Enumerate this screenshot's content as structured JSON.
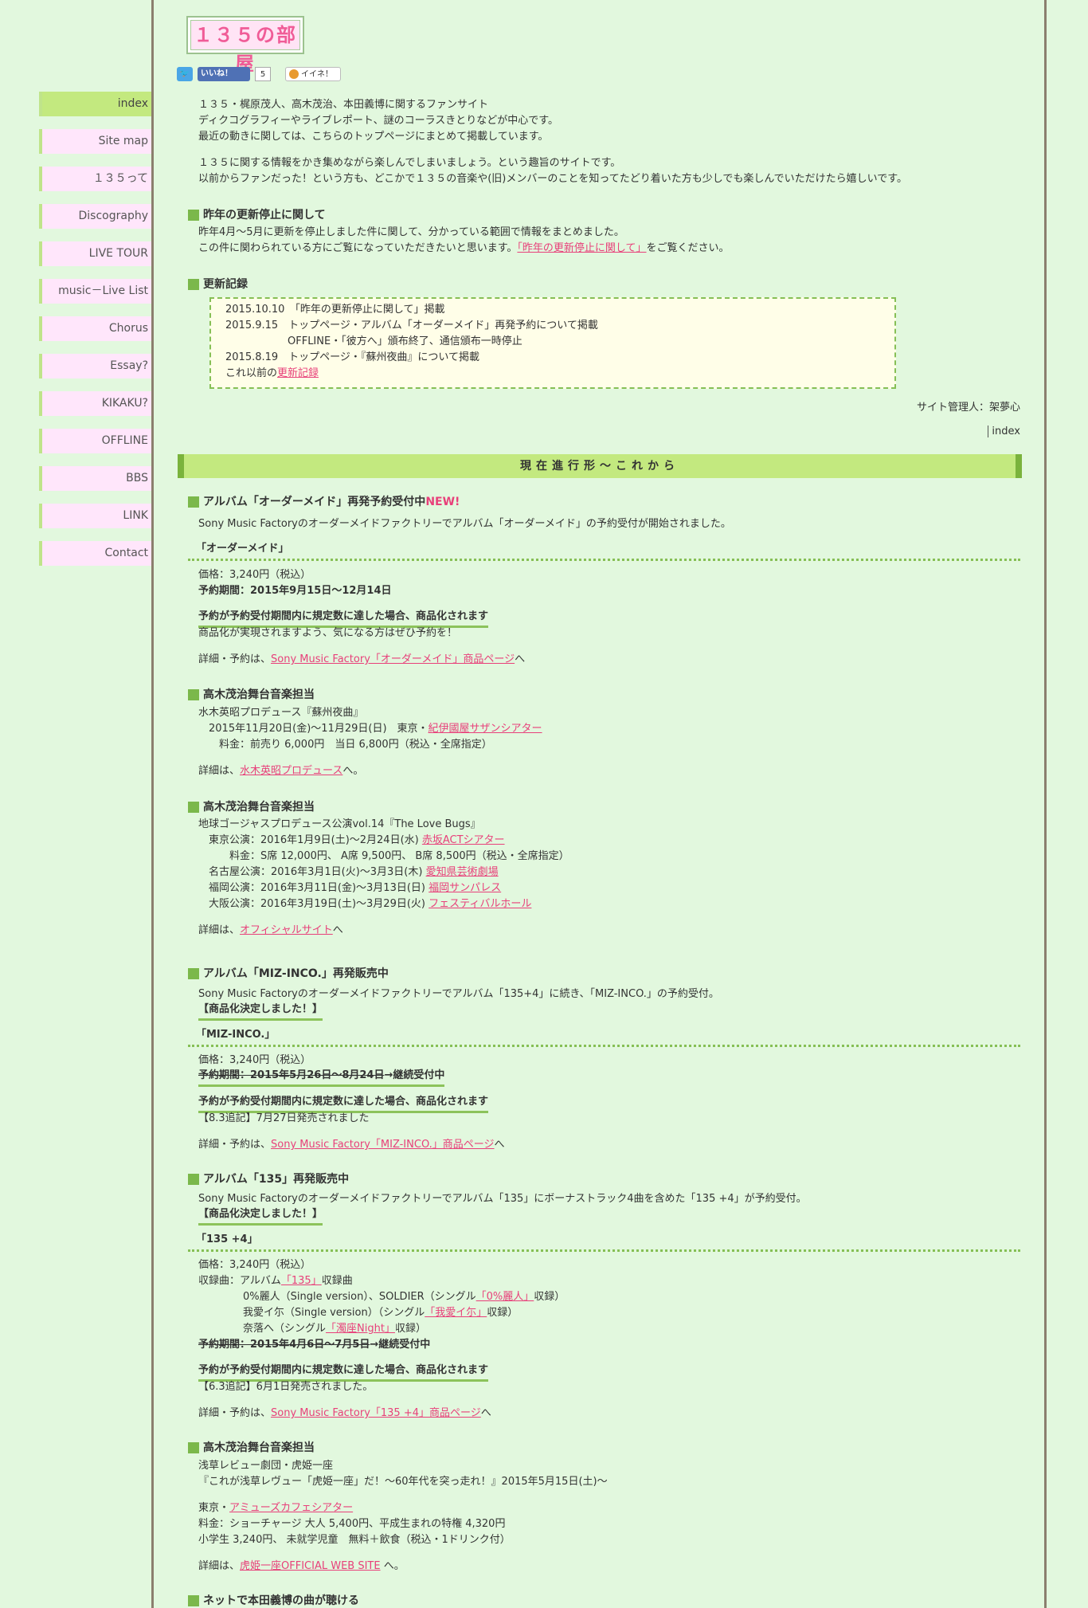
{
  "site": {
    "logo": "１３５の部屋"
  },
  "social": {
    "tweet": "",
    "like_label": "いいね！",
    "like_count": "5",
    "mixi_label": "イイネ！"
  },
  "nav": [
    {
      "label": "index",
      "active": true
    },
    {
      "label": "Site map"
    },
    {
      "label": "１３５って"
    },
    {
      "label": "Discography"
    },
    {
      "label": "LIVE TOUR"
    },
    {
      "label": "music－Live List"
    },
    {
      "label": "Chorus"
    },
    {
      "label": "Essay?"
    },
    {
      "label": "KIKAKU?"
    },
    {
      "label": "OFFLINE"
    },
    {
      "label": "BBS"
    },
    {
      "label": "LINK"
    },
    {
      "label": "Contact"
    }
  ],
  "intro": {
    "l1": "１３５・梶原茂人、高木茂治、本田義博に関するファンサイト",
    "l2": "ディクコグラフィーやライブレポート、謎のコーラスきとりなどが中心です。",
    "l3": "最近の動きに関しては、こちらのトップページにまとめて掲載しています。",
    "l4": "１３５に関する情報をかき集めながら楽しんでしまいましょう。という趣旨のサイトです。",
    "l5": "以前からファンだった！という方も、どこかで１３５の音楽や(旧)メンバーのことを知ってたどり着いた方も少しでも楽しんでいただけたら嬉しいです。"
  },
  "stop": {
    "title": "昨年の更新停止に関して",
    "l1": "昨年4月～5月に更新を停止しました件に関して、分かっている範囲で情報をまとめました。",
    "l2a": "この件に関わられている方にご覧になっていただきたいと思います。",
    "l2link": "「昨年の更新停止に関して」",
    "l2b": "をご覧ください。"
  },
  "updates": {
    "title": "更新記録",
    "lines": [
      "2015.10.10　「昨年の更新停止に関して」掲載",
      "2015.9.15　トップページ・アルバム「オーダーメイド」再発予約について掲載",
      "　　　　　　OFFLINE・「彼方へ」頒布終了、通信頒布一時停止",
      "2015.8.19　トップページ・『蘇州夜曲』について掲載"
    ],
    "more_a": "これ以前の",
    "more_link": "更新記録"
  },
  "admin": "サイト管理人：架夢心",
  "index_link": "index",
  "banner": "現在進行形～これから",
  "s1": {
    "title": "アルバム「オーダーメイド」再発予約受付中",
    "new": "NEW!",
    "desc": "Sony Music Factoryのオーダーメイドファクトリーでアルバム「オーダーメイド」の予約受付が開始されました。",
    "sub": "「オーダーメイド」",
    "price": "価格：3,240円（税込）",
    "period": "予約期間：2015年9月15日～12月14日",
    "cond": "予約が予約受付期間内に規定数に達した場合、商品化されます",
    "note": "商品化が実現されますよう、気になる方はぜひ予約を！",
    "more_a": "詳細・予約は、",
    "more_link": "Sony Music Factory「オーダーメイド」商品ページ",
    "more_b": "へ"
  },
  "s2": {
    "title": "高木茂治舞台音楽担当",
    "l1": "水木英昭プロデュース『蘇州夜曲』",
    "l2a": "　2015年11月20日(金)～11月29日(日)　東京・",
    "l2link": "紀伊國屋サザンシアター",
    "l3": "　　料金：前売り 6,000円　当日 6,800円（税込・全席指定）",
    "more_a": "詳細は、",
    "more_link": "水木英昭プロデュース",
    "more_b": "へ。"
  },
  "s3": {
    "title": "高木茂治舞台音楽担当",
    "l1": "地球ゴージャスプロデュース公演vol.14『The Love Bugs』",
    "l2a": "　東京公演：2016年1月9日(土)～2月24日(水) ",
    "l2link": "赤坂ACTシアター",
    "l3": "　　　料金：S席 12,000円、 A席 9,500円、 B席 8,500円（税込・全席指定）",
    "l4a": "　名古屋公演：2016年3月1日(火)～3月3日(木) ",
    "l4link": "愛知県芸術劇場",
    "l5a": "　福岡公演：2016年3月11日(金)～3月13日(日) ",
    "l5link": "福岡サンパレス",
    "l6a": "　大阪公演：2016年3月19日(土)～3月29日(火) ",
    "l6link": "フェスティバルホール",
    "more_a": "詳細は、",
    "more_link": "オフィシャルサイト",
    "more_b": "へ"
  },
  "s4": {
    "title": "アルバム「MIZ-INCO.」再発販売中",
    "desc": "Sony Music Factoryのオーダーメイドファクトリーでアルバム「135+4」に続き、「MIZ-INCO.」の予約受付。",
    "decided": "【商品化決定しました！】",
    "sub": "「MIZ-INCO.」",
    "price": "価格：3,240円（税込）",
    "period_strike": "予約期間：2015年5月26日～8月24日",
    "period_b": "→継続受付中",
    "cond": "予約が予約受付期間内に規定数に達した場合、商品化されます",
    "note": "【8.3追記】7月27日発売されました",
    "more_a": "詳細・予約は、",
    "more_link": "Sony Music Factory「MIZ-INCO.」商品ページ",
    "more_b": "へ"
  },
  "s5": {
    "title": "アルバム「135」再発販売中",
    "desc": "Sony Music Factoryのオーダーメイドファクトリーでアルバム「135」にボーナストラック4曲を含めた「135 +4」が予約受付。",
    "decided": "【商品化決定しました！】",
    "sub": "「135 +4」",
    "price": "価格：3,240円（税込）",
    "tr_a": "収録曲：アルバム",
    "tr_link": "「135」",
    "tr_b": "収録曲",
    "t1a": "0%麗人（Single version）、SOLDIER（シングル",
    "t1link": "「0%麗人」",
    "t1b": "収録）",
    "t2a": "我愛イ尓（Single version）（シングル",
    "t2link": "「我愛イ尓」",
    "t2b": "収録）",
    "t3a": "奈落へ（シングル",
    "t3link": "「濁座Night」",
    "t3b": "収録）",
    "period_strike": "予約期間：2015年4月6日～7月5日",
    "period_b": "→継続受付中",
    "cond": "予約が予約受付期間内に規定数に達した場合、商品化されます",
    "note": "【6.3追記】6月1日発売されました。",
    "more_a": "詳細・予約は、",
    "more_link": "Sony Music Factory「135 +4」商品ページ",
    "more_b": "へ"
  },
  "s6": {
    "title": "高木茂治舞台音楽担当",
    "l1": "浅草レビュー劇団・虎姫一座",
    "l2": "『これが浅草レヴュー「虎姫一座」だ！～60年代を突っ走れ！』2015年5月15日(土)～",
    "l3a": "東京・",
    "l3link": "アミューズカフェシアター",
    "l4": "料金：ショーチャージ 大人 5,400円、平成生まれの特権 4,320円",
    "l5": "小学生 3,240円、 未就学児童　無料＋飲食（税込・1ドリンク付）",
    "more_a": "詳細は、",
    "more_link": "虎姫一座OFFICIAL WEB SITE",
    "more_b": " へ。"
  },
  "s7": {
    "title": "ネットで本田義博の曲が聴ける"
  }
}
